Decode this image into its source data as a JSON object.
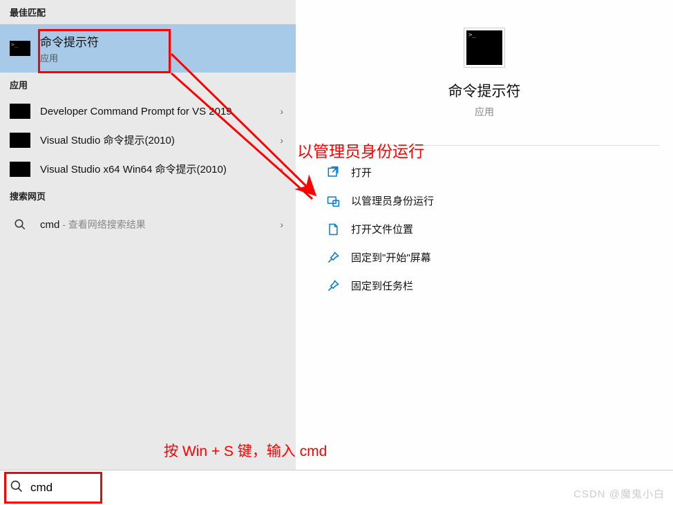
{
  "left": {
    "best_match_header": "最佳匹配",
    "best_match": {
      "title": "命令提示符",
      "sub": "应用"
    },
    "apps_header": "应用",
    "apps": [
      {
        "label": "Developer Command Prompt for VS 2019"
      },
      {
        "label": "Visual Studio 命令提示(2010)"
      },
      {
        "label": "Visual Studio x64 Win64 命令提示(2010)"
      }
    ],
    "web_header": "搜索网页",
    "web": {
      "query": "cmd",
      "hint": " - 查看网络搜索结果"
    }
  },
  "right": {
    "title": "命令提示符",
    "sub": "应用",
    "actions": [
      {
        "label": "打开",
        "icon": "open"
      },
      {
        "label": "以管理员身份运行",
        "icon": "admin"
      },
      {
        "label": "打开文件位置",
        "icon": "folder"
      },
      {
        "label": "固定到\"开始\"屏幕",
        "icon": "pin"
      },
      {
        "label": "固定到任务栏",
        "icon": "pin"
      }
    ]
  },
  "search": {
    "value": "cmd"
  },
  "annotations": {
    "admin": "以管理员身份运行",
    "hint": "按 Win + S 键，输入 cmd"
  },
  "watermark": "CSDN @魔鬼小白"
}
